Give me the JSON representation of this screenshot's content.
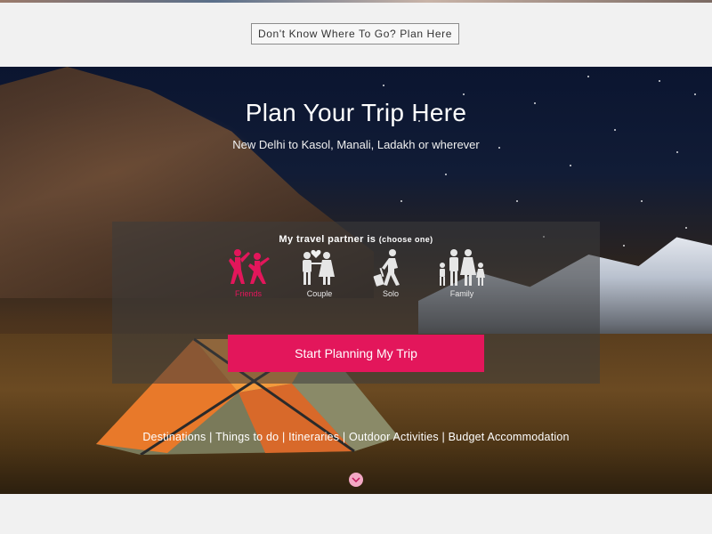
{
  "top_bar": {
    "plan_here_label": "Don't Know Where To Go? Plan Here"
  },
  "hero": {
    "title": "Plan Your Trip Here",
    "subtitle": "New Delhi to Kasol, Manali, Ladakh or wherever"
  },
  "partner_panel": {
    "label": "My travel partner is",
    "label_hint": "(choose one)",
    "options": [
      {
        "label": "Friends",
        "icon": "friends-icon",
        "active": true
      },
      {
        "label": "Couple",
        "icon": "couple-icon",
        "active": false
      },
      {
        "label": "Solo",
        "icon": "solo-traveller-icon",
        "active": false
      },
      {
        "label": "Family",
        "icon": "family-icon",
        "active": false
      }
    ],
    "start_button": "Start Planning My Trip"
  },
  "bottom_links": [
    "Destinations",
    "Things to do",
    "Itineraries",
    "Outdoor Activities",
    "Budget Accommodation"
  ],
  "colors": {
    "accent": "#e3165b",
    "scroll_button": "#f3a8c4"
  }
}
